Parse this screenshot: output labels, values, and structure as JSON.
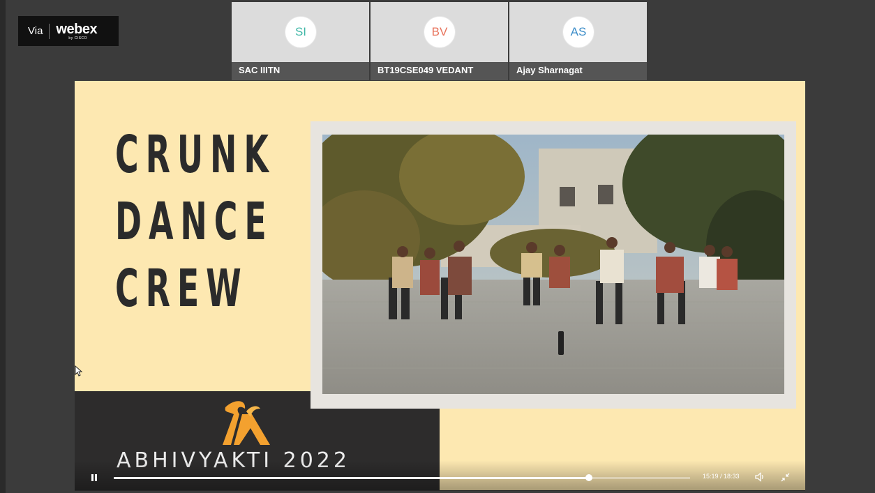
{
  "webex": {
    "via": "Via",
    "brand": "webex",
    "sub": "by CISCO"
  },
  "participants": [
    {
      "initials": "SI",
      "name": "SAC IIITN",
      "color": "#3fb7a7"
    },
    {
      "initials": "BV",
      "name": "BT19CSE049 VEDANT",
      "color": "#e8735c"
    },
    {
      "initials": "AS",
      "name": "Ajay Sharnagat",
      "color": "#3d8ec9"
    }
  ],
  "slide": {
    "title_lines": [
      "CRUNK",
      "DANCE",
      "CREW"
    ],
    "event_name": "ABHIVYAKTI 2022",
    "logo": "abhivyakti-flame-logo",
    "photo": "dance-crew-photo"
  },
  "player": {
    "current_time": "15:19",
    "total_time": "18:33",
    "time_label": "15:19 / 18:33",
    "progress": 0.825,
    "icons": {
      "pause": "pause-icon",
      "volume": "volume-icon",
      "collapse": "collapse-icon"
    }
  },
  "colors": {
    "slide_bg": "#fde8b1",
    "dark_band": "#2d2c2c",
    "logo_orange": "#f3a12f"
  }
}
